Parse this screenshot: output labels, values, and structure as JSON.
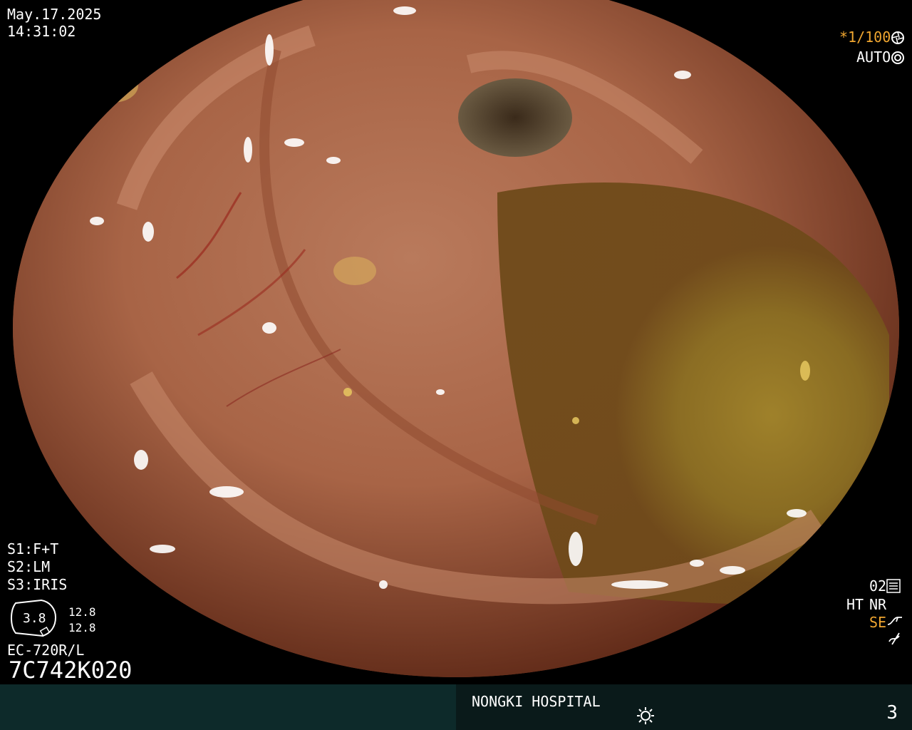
{
  "datetime": {
    "date": "May.17.2025",
    "time": "14:31:02"
  },
  "shutter": {
    "value": "*1/100",
    "mode": "AUTO"
  },
  "settings": {
    "s1": "S1:F+T",
    "s2": "S2:LM",
    "s3": "S3:IRIS"
  },
  "gauge": {
    "value": "3.8",
    "upper": "12.8",
    "lower": "12.8"
  },
  "scope_model": "EC-720R/L",
  "serial": "7C742K020",
  "right_status": {
    "line1": "02",
    "ht": "HT",
    "nr": "NR",
    "se": "SE"
  },
  "footer": {
    "hospital": "NONGKI HOSPITAL",
    "page": "3"
  },
  "colors": {
    "accent": "#f0a630",
    "panel_left": "#0d2a2a",
    "panel_right": "#0a1a1a"
  },
  "icons": {
    "shutter": "aperture-icon",
    "auto": "auto-gear-icon",
    "enhance": "enhance-icon",
    "se": "se-curve-icon",
    "freeze": "freeze-icon",
    "light": "light-sun-icon"
  }
}
